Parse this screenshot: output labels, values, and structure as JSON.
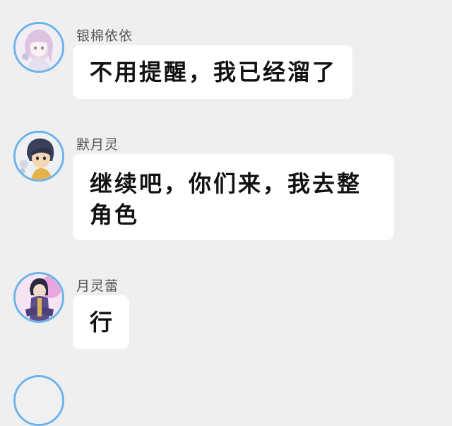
{
  "messages": [
    {
      "sender": "银棉依依",
      "text": "不用提醒，我已经溜了",
      "avatar_icon": "anime-girl-avatar"
    },
    {
      "sender": "默月灵",
      "text": "继续吧，你们来，我去整角色",
      "avatar_icon": "anime-boy-avatar"
    },
    {
      "sender": "月灵蕾",
      "text": "行",
      "avatar_icon": "anime-character-purple-avatar"
    }
  ],
  "colors": {
    "background": "#efefef",
    "bubble": "#ffffff",
    "avatar_border": "#6cb3ec",
    "sender_text": "#555555",
    "message_text": "#111111"
  }
}
